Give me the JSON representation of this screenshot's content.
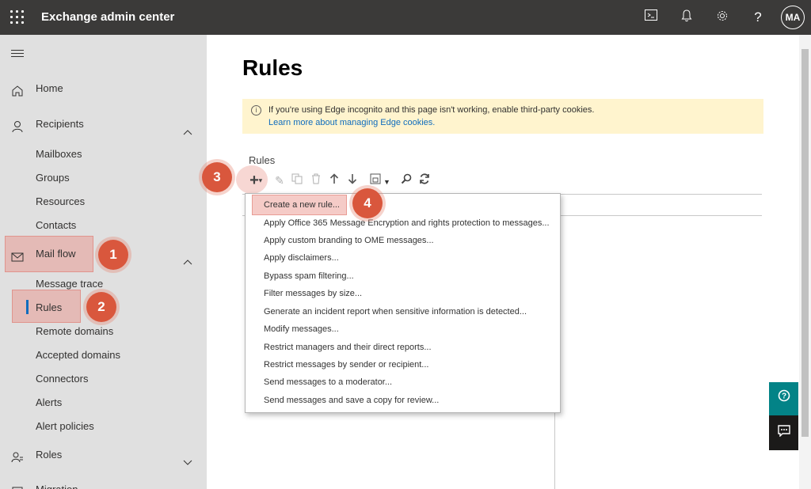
{
  "header": {
    "app_title": "Exchange admin center",
    "icons": [
      "shell-icon",
      "bell-icon",
      "gear-icon",
      "help-icon"
    ],
    "avatar_initials": "MA",
    "bg_color": "#3b3a39"
  },
  "sidebar": {
    "home": "Home",
    "recipients": "Recipients",
    "recipients_children": [
      "Mailboxes",
      "Groups",
      "Resources",
      "Contacts"
    ],
    "mail_flow": "Mail flow",
    "mail_flow_children": [
      "Message trace",
      "Rules",
      "Remote domains",
      "Accepted domains",
      "Connectors",
      "Alerts",
      "Alert policies"
    ],
    "roles": "Roles",
    "migration": "Migration",
    "active_item": "Rules"
  },
  "main": {
    "page_title": "Rules",
    "banner": {
      "message": "If you're using Edge incognito and this page isn't working, enable third-party cookies.",
      "link": "Learn more about managing Edge cookies."
    },
    "section_label": "Rules",
    "toolbar": [
      "add-icon",
      "edit-icon",
      "copy-icon",
      "delete-icon",
      "move-up-icon",
      "move-down-icon",
      "export-icon",
      "search-icon",
      "refresh-icon"
    ],
    "new_rule_menu": [
      "Create a new rule...",
      "Apply Office 365 Message Encryption and rights protection to messages...",
      "Apply custom branding to OME messages...",
      "Apply disclaimers...",
      "Bypass spam filtering...",
      "Filter messages by size...",
      "Generate an incident report when sensitive information is detected...",
      "Modify messages...",
      "Restrict managers and their direct reports...",
      "Restrict messages by sender or recipient...",
      "Send messages to a moderator...",
      "Send messages and save a copy for review..."
    ]
  },
  "step_badges": [
    "1",
    "2",
    "3",
    "4"
  ],
  "colors": {
    "accent": "#0f6cbd",
    "badge": "#d9573d",
    "banner_bg": "#fff4ce",
    "help_button": "#038387"
  }
}
